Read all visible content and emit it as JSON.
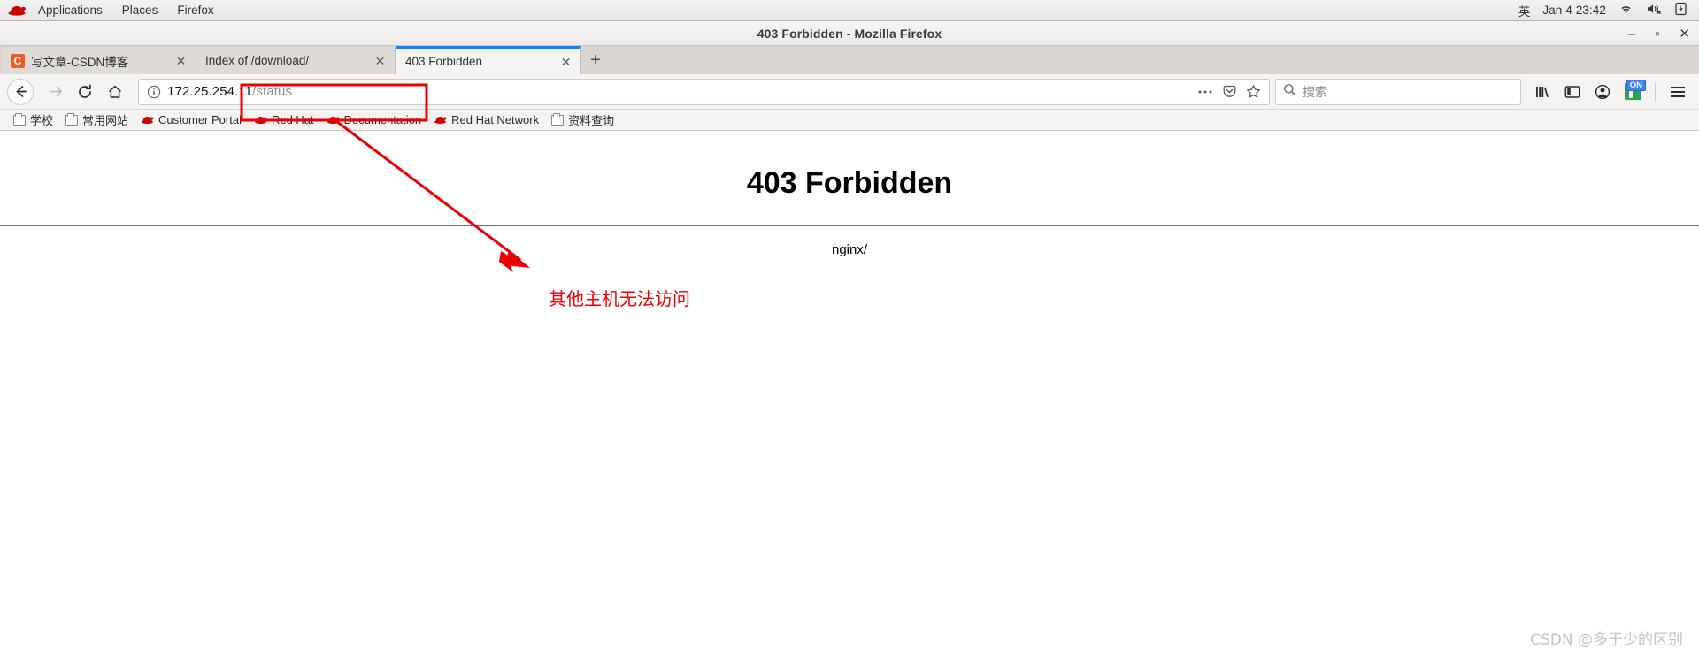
{
  "desktop_panel": {
    "logo_icon": "redhat-logo-icon",
    "menus": [
      "Applications",
      "Places",
      "Firefox"
    ],
    "ime_indicator": "英",
    "clock": "Jan 4 23:42",
    "tray_icons": [
      "wifi-icon",
      "volume-muted-icon",
      "battery-charging-icon"
    ]
  },
  "window": {
    "title": "403 Forbidden - Mozilla Firefox",
    "controls": {
      "minimize": "–",
      "maximize": "▫",
      "close": "✕"
    }
  },
  "tabs": {
    "items": [
      {
        "label": "写文章-CSDN博客",
        "favicon_letter": "C",
        "favicon_color": "#f05a28",
        "active": false,
        "close_label": "✕"
      },
      {
        "label": "Index of /download/",
        "favicon_letter": "",
        "favicon_color": "transparent",
        "active": false,
        "close_label": "✕"
      },
      {
        "label": "403 Forbidden",
        "favicon_letter": "",
        "favicon_color": "transparent",
        "active": true,
        "close_label": "✕"
      }
    ],
    "new_tab_label": "+",
    "active_tab_accent": "#0a84ff"
  },
  "navbar": {
    "back_icon": "back-arrow-icon",
    "forward_icon": "forward-arrow-icon",
    "reload_icon": "reload-icon",
    "home_icon": "home-icon",
    "url": {
      "host": "172.25.254.11",
      "path": "/status",
      "full": "172.25.254.11/status"
    },
    "identity_icon": "info-circle-icon",
    "page_actions_icon": "ellipsis-icon",
    "pocket_icon": "pocket-icon",
    "bookmark_icon": "star-icon",
    "search_placeholder": "搜索",
    "search_value": "",
    "right_icons": [
      "library-icon",
      "sidebar-icon",
      "account-icon",
      "extension-icon",
      "menu-icon"
    ],
    "extension_badge": "ON"
  },
  "bookmarks": {
    "items": [
      {
        "label": "学校",
        "icon": "folder-icon"
      },
      {
        "label": "常用网站",
        "icon": "folder-icon"
      },
      {
        "label": "Customer Portal",
        "icon": "redhat-icon"
      },
      {
        "label": "Red Hat",
        "icon": "redhat-icon"
      },
      {
        "label": "Documentation",
        "icon": "redhat-icon"
      },
      {
        "label": "Red Hat Network",
        "icon": "redhat-icon"
      },
      {
        "label": "资料查询",
        "icon": "folder-icon"
      }
    ]
  },
  "page": {
    "heading": "403 Forbidden",
    "server": "nginx/"
  },
  "annotations": {
    "highlight_color": "#ee0000",
    "note_text": "其他主机无法访问",
    "arrow": "red-arrow-icon",
    "url_highlight_box": "red-rectangle-highlight"
  },
  "watermark": {
    "text": "CSDN @多于少的区别"
  }
}
